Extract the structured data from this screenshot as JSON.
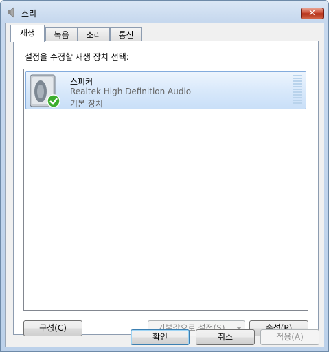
{
  "window": {
    "title": "소리"
  },
  "tabs": [
    {
      "label": "재생"
    },
    {
      "label": "녹음"
    },
    {
      "label": "소리"
    },
    {
      "label": "통신"
    }
  ],
  "panel": {
    "prompt": "설정을 수정할 재생 장치 선택:"
  },
  "device": {
    "name": "스피커",
    "description": "Realtek High Definition Audio",
    "status": "기본 장치",
    "icon": "speaker-icon",
    "status_icon": "green-check-icon"
  },
  "buttons": {
    "configure": "구성(C)",
    "set_default": "기본값으로 설정(S)",
    "properties": "속성(P)",
    "ok": "확인",
    "cancel": "취소",
    "apply": "적용(A)"
  },
  "icons": {
    "title": "speaker-title-icon",
    "close": "close-icon"
  },
  "colors": {
    "selection": "#d9e9fb",
    "close_button": "#c8452d",
    "check": "#3cae2e"
  }
}
